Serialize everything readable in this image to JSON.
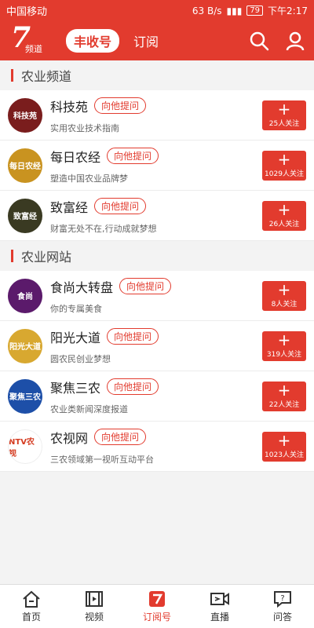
{
  "status": {
    "carrier": "中国移动",
    "speed": "63 B/s",
    "battery": "79",
    "time": "下午2:17"
  },
  "header": {
    "logo_text": "7",
    "logo_sub": "频道",
    "tabs": [
      {
        "label": "丰收号",
        "active": true
      },
      {
        "label": "订阅",
        "active": false
      }
    ]
  },
  "sections": [
    {
      "title": "农业频道",
      "items": [
        {
          "name": "科技苑",
          "ask": "向他提问",
          "desc": "实用农业技术指南",
          "follow": "25人关注",
          "avatar_text": "科技苑",
          "color": "#7a1d1d"
        },
        {
          "name": "每日农经",
          "ask": "向他提问",
          "desc": "塑造中国农业品牌梦",
          "follow": "1029人关注",
          "avatar_text": "每日农经",
          "color": "#c99320"
        },
        {
          "name": "致富经",
          "ask": "向他提问",
          "desc": "财富无处不在,行动成就梦想",
          "follow": "26人关注",
          "avatar_text": "致富经",
          "color": "#3a3a22"
        }
      ]
    },
    {
      "title": "农业网站",
      "items": [
        {
          "name": "食尚大转盘",
          "ask": "向他提问",
          "desc": "你的专属美食",
          "follow": "8人关注",
          "avatar_text": "食尚",
          "color": "#5b1a6b"
        },
        {
          "name": "阳光大道",
          "ask": "向他提问",
          "desc": "圆农民创业梦想",
          "follow": "319人关注",
          "avatar_text": "阳光大道",
          "color": "#d8a830"
        },
        {
          "name": "聚焦三农",
          "ask": "向他提问",
          "desc": "农业类新闻深度报道",
          "follow": "22人关注",
          "avatar_text": "聚焦三农",
          "color": "#1d4fa8"
        },
        {
          "name": "农视网",
          "ask": "向他提问",
          "desc": "三农领域第一视听互动平台",
          "follow": "1023人关注",
          "avatar_text": "NTV农视",
          "color": "#ffffff"
        }
      ]
    }
  ],
  "bottom_nav": [
    {
      "label": "首页",
      "icon": "home-icon",
      "active": false
    },
    {
      "label": "视频",
      "icon": "video-icon",
      "active": false
    },
    {
      "label": "订阅号",
      "icon": "subscribe-icon",
      "active": true
    },
    {
      "label": "直播",
      "icon": "live-icon",
      "active": false
    },
    {
      "label": "问答",
      "icon": "qa-icon",
      "active": false
    }
  ],
  "colors": {
    "accent": "#e23b2e"
  }
}
